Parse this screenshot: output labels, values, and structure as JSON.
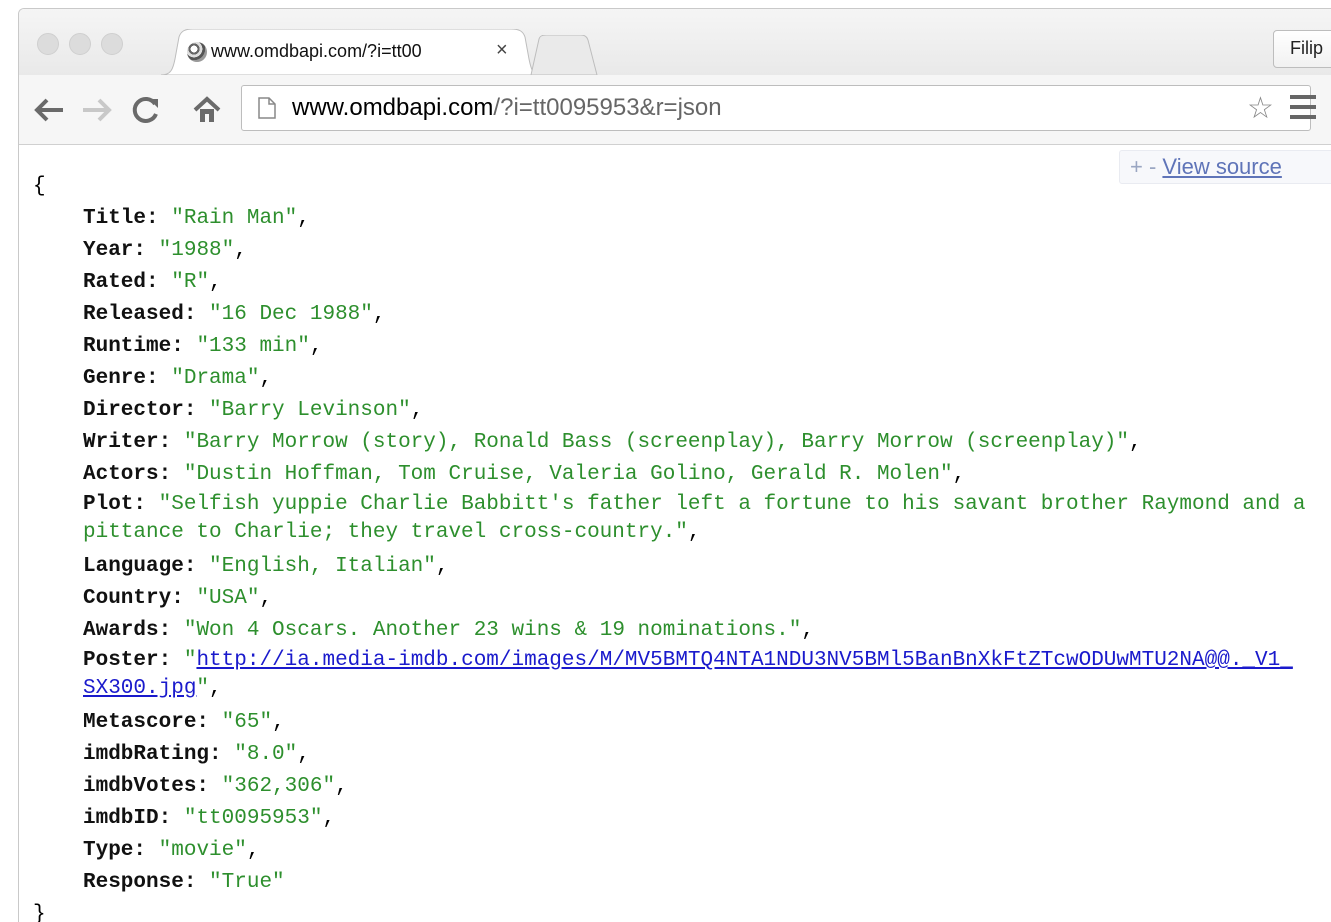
{
  "browser": {
    "tab_title": "www.omdbapi.com/?i=tt00",
    "tab_close": "×",
    "profile_name": "Filip",
    "url_host": "www.omdbapi.com",
    "url_rest": "/?i=tt0095953&r=json",
    "icons": [
      "back-arrow-icon",
      "forward-arrow-icon",
      "reload-icon",
      "home-icon",
      "page-icon",
      "bookmark-star-icon",
      "menu-icon"
    ]
  },
  "viewer": {
    "controls": "+ -",
    "view_source": "View source"
  },
  "json_doc": {
    "open_brace": "{",
    "close_brace": "}",
    "fields": [
      {
        "key": "Title",
        "value": "\"Rain Man\""
      },
      {
        "key": "Year",
        "value": "\"1988\""
      },
      {
        "key": "Rated",
        "value": "\"R\""
      },
      {
        "key": "Released",
        "value": "\"16 Dec 1988\""
      },
      {
        "key": "Runtime",
        "value": "\"133 min\""
      },
      {
        "key": "Genre",
        "value": "\"Drama\""
      },
      {
        "key": "Director",
        "value": "\"Barry Levinson\""
      },
      {
        "key": "Writer",
        "value": "\"Barry Morrow (story), Ronald Bass (screenplay), Barry Morrow (screenplay)\""
      },
      {
        "key": "Actors",
        "value": "\"Dustin Hoffman, Tom Cruise, Valeria Golino, Gerald R. Molen\""
      },
      {
        "key": "Plot",
        "value": "\"Selfish yuppie Charlie Babbitt's father left a fortune to his savant brother Raymond and a pittance to Charlie; they travel cross-country.\""
      },
      {
        "key": "Language",
        "value": "\"English, Italian\""
      },
      {
        "key": "Country",
        "value": "\"USA\""
      },
      {
        "key": "Awards",
        "value": "\"Won 4 Oscars. Another 23 wins & 19 nominations.\""
      },
      {
        "key": "Poster",
        "value": "http://ia.media-imdb.com/images/M/MV5BMTQ4NTA1NDU3NV5BMl5BanBnXkFtZTcwODUwMTU2NA@@._V1_SX300.jpg"
      },
      {
        "key": "Metascore",
        "value": "\"65\""
      },
      {
        "key": "imdbRating",
        "value": "\"8.0\""
      },
      {
        "key": "imdbVotes",
        "value": "\"362,306\""
      },
      {
        "key": "imdbID",
        "value": "\"tt0095953\""
      },
      {
        "key": "Type",
        "value": "\"movie\""
      },
      {
        "key": "Response",
        "value": "\"True\""
      }
    ]
  },
  "colors": {
    "string_value": "#2d8f2d",
    "link": "#1a1acc",
    "view_source_link": "#5f74b8"
  }
}
